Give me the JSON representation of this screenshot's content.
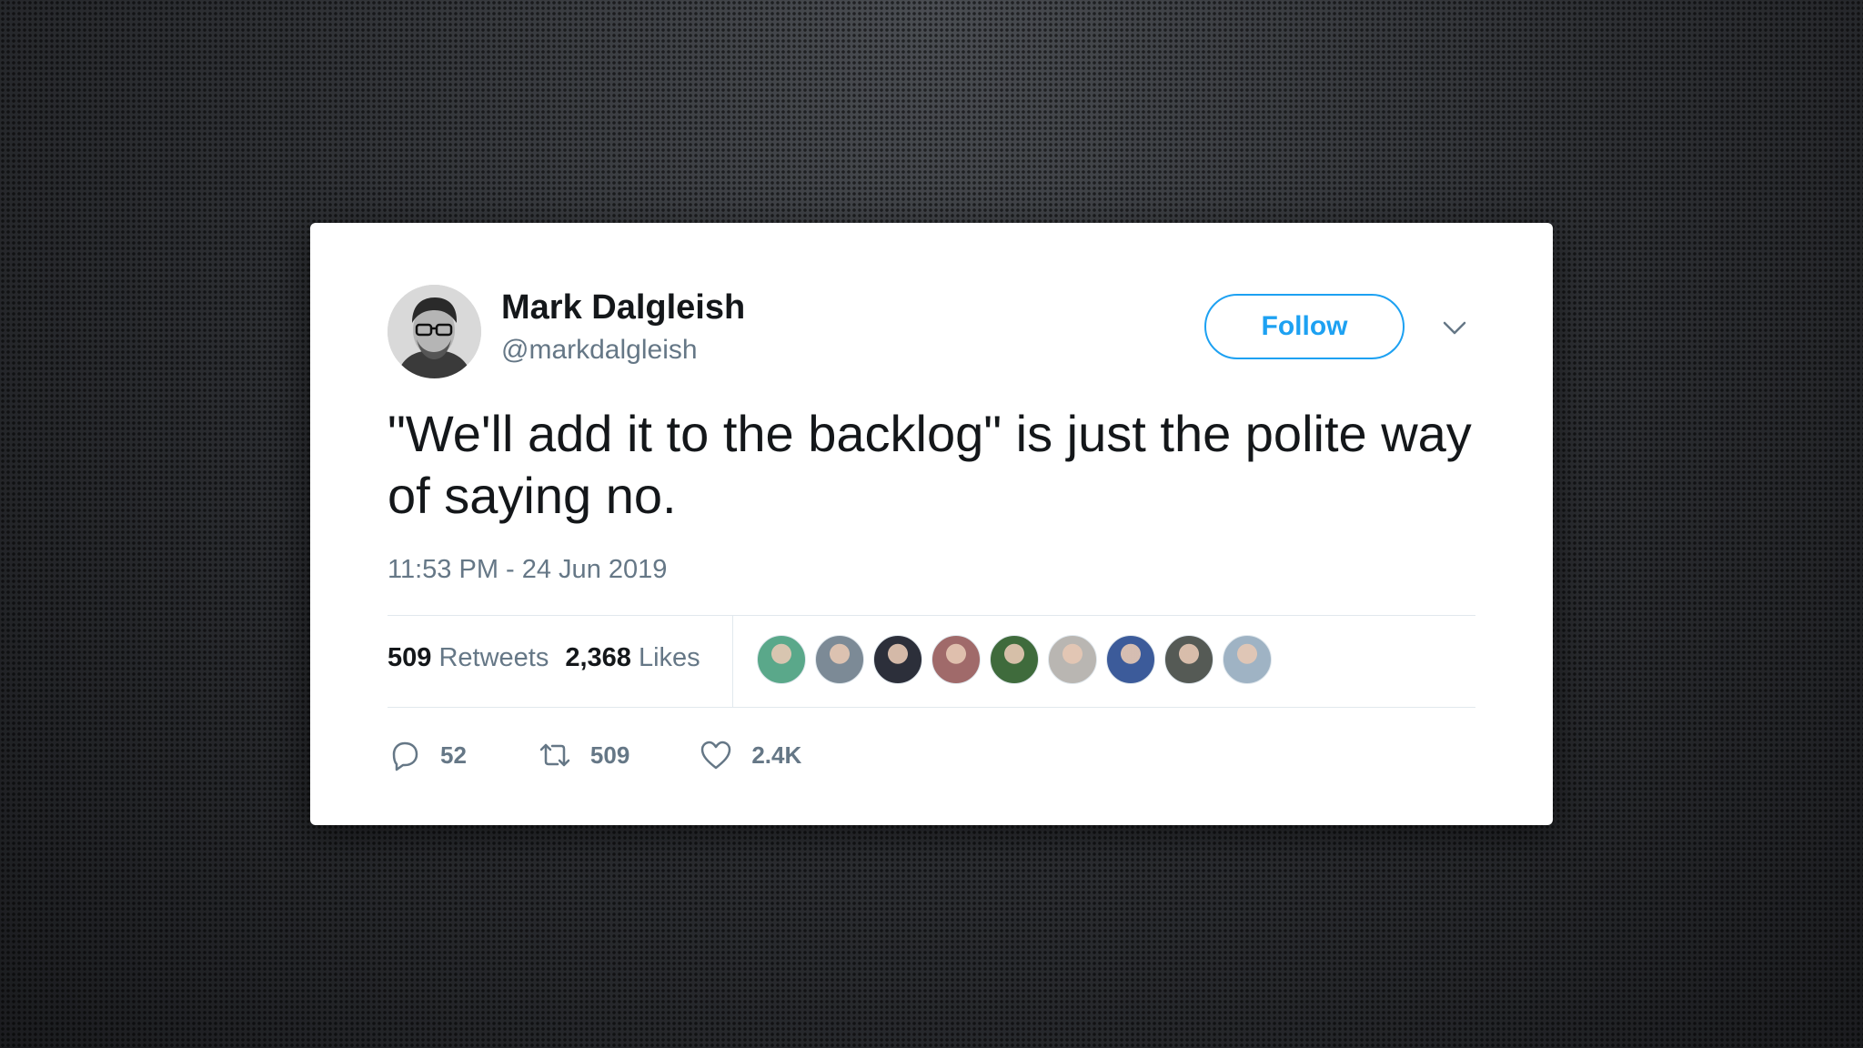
{
  "tweet": {
    "author_name": "Mark Dalgleish",
    "author_handle": "@markdalgleish",
    "follow_label": "Follow",
    "text": "\"We'll add it to the backlog\" is just the polite way of saying no.",
    "timestamp": "11:53 PM - 24 Jun 2019",
    "stats": {
      "retweets_count": "509",
      "retweets_label": "Retweets",
      "likes_count": "2,368",
      "likes_label": "Likes"
    },
    "liker_avatars": [
      {
        "color": "#5aa88a"
      },
      {
        "color": "#7c8a96"
      },
      {
        "color": "#2c2f3a"
      },
      {
        "color": "#a06a6a"
      },
      {
        "color": "#3f6b3c"
      },
      {
        "color": "#b9b6b2"
      },
      {
        "color": "#3c5b9a"
      },
      {
        "color": "#555a55"
      },
      {
        "color": "#9fb3c4"
      }
    ],
    "actions": {
      "reply_count": "52",
      "retweet_count": "509",
      "like_count": "2.4K"
    }
  },
  "colors": {
    "accent": "#1da1f2",
    "text_primary": "#14171a",
    "text_secondary": "#657786"
  }
}
